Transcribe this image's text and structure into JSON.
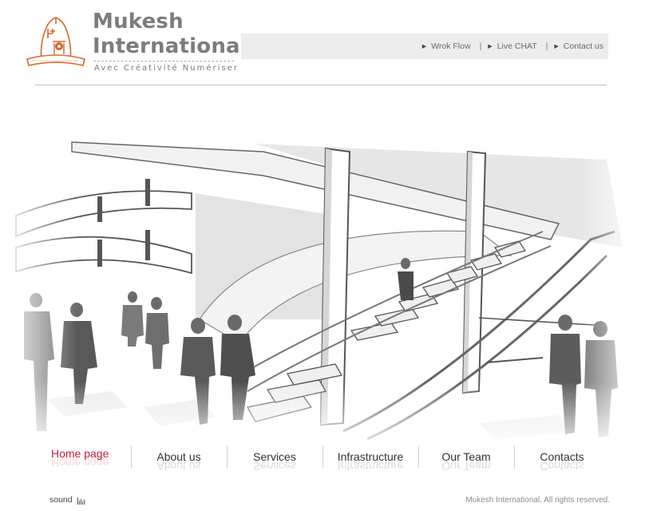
{
  "brand": {
    "name_line1": "Mukesh",
    "name_line2": "International",
    "tagline": "Avec Créativité Numériser",
    "accent_color": "#d2692a"
  },
  "top_links": [
    {
      "label": "Wrok Flow",
      "icon": "triangle-bullet-icon"
    },
    {
      "label": "Live CHAT",
      "icon": "triangle-bullet-icon"
    },
    {
      "label": "Contact us",
      "icon": "triangle-bullet-icon"
    }
  ],
  "nav": [
    {
      "label": "Home page",
      "active": true
    },
    {
      "label": "About us"
    },
    {
      "label": "Services"
    },
    {
      "label": "Infrastructure"
    },
    {
      "label": "Our Team"
    },
    {
      "label": "Contacts"
    }
  ],
  "nav_active_color": "#c21e35",
  "footer": {
    "sound_label": "sound",
    "copyright": "Mukesh International. All rights reserved."
  }
}
